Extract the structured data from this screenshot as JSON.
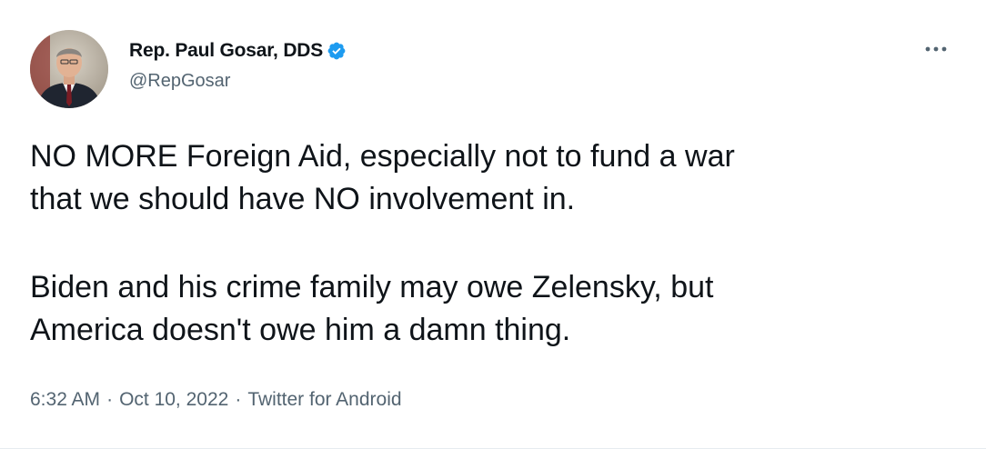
{
  "author": {
    "display_name": "Rep. Paul Gosar, DDS",
    "handle": "@RepGosar",
    "verified": true,
    "verified_color": "#1d9bf0"
  },
  "tweet": {
    "paragraphs": [
      [
        "NO MORE Foreign Aid, especially not to fund a war",
        "that we should have NO involvement in."
      ],
      [
        "Biden and his crime family may owe Zelensky, but",
        "America doesn't owe him a damn thing."
      ]
    ]
  },
  "meta": {
    "time": "6:32 AM",
    "separator": "·",
    "date": "Oct 10, 2022",
    "source": "Twitter for Android"
  },
  "icons": {
    "more": "more-horizontal-icon",
    "verified": "verified-badge-icon"
  }
}
